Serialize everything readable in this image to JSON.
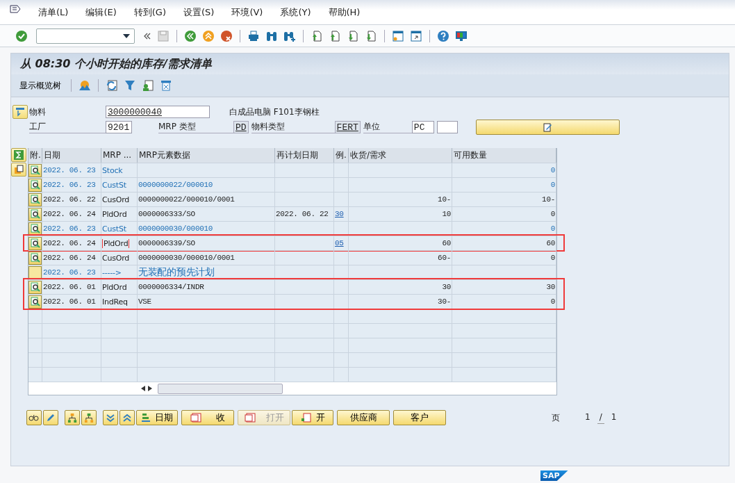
{
  "menu": [
    "清单(L)",
    "编辑(E)",
    "转到(G)",
    "设置(S)",
    "环境(V)",
    "系统(Y)",
    "帮助(H)"
  ],
  "title": "从 08:30 个小时开始的库存/需求清单",
  "app_toolbar": {
    "button": "显示概览树"
  },
  "header": {
    "material_label": "物料",
    "material": "3000000040",
    "description": "白成品电脑 F101李钢柱",
    "plant_label": "工厂",
    "plant": "9201",
    "mrp_type_label": "MRP 类型",
    "mrp_type": "PD",
    "material_type_label": "物料类型",
    "material_type": "FERT",
    "unit_label": "单位",
    "unit": "PC"
  },
  "table": {
    "columns": [
      "附.",
      "日期",
      "MRP ...",
      "MRP元素数据",
      "再计划日期",
      "例.",
      "收货/需求",
      "可用数量"
    ],
    "rows": [
      {
        "kind": "detail",
        "secondary": true,
        "highlighted": false,
        "type_marked": false,
        "date": "2022. 06. 23",
        "mrp": "Stock",
        "available": "0"
      },
      {
        "kind": "detail",
        "secondary": true,
        "highlighted": false,
        "type_marked": false,
        "date": "2022. 06. 23",
        "mrp": "CustSt",
        "element": "0000000022/000010",
        "available": "0"
      },
      {
        "kind": "detail",
        "secondary": false,
        "highlighted": false,
        "type_marked": false,
        "date": "2022. 06. 22",
        "mrp": "CusOrd",
        "element": "0000000022/000010/0001",
        "quantity": "10-",
        "available": "10-"
      },
      {
        "kind": "detail",
        "secondary": false,
        "highlighted": false,
        "type_marked": false,
        "date": "2022. 06. 24",
        "mrp": "PldOrd",
        "element": "0000006333/SO",
        "reschedule": "2022. 06. 22",
        "exception": "30",
        "quantity": "10",
        "available": "0"
      },
      {
        "kind": "detail",
        "secondary": true,
        "highlighted": false,
        "type_marked": false,
        "date": "2022. 06. 23",
        "mrp": "CustSt",
        "element": "0000000030/000010",
        "available": "0"
      },
      {
        "kind": "detail",
        "secondary": false,
        "highlighted": true,
        "type_marked": true,
        "date": "2022. 06. 24",
        "mrp": "PldOrd",
        "element": "0000006339/SO",
        "exception": "05",
        "quantity": "60",
        "available": "60"
      },
      {
        "kind": "detail",
        "secondary": false,
        "highlighted": false,
        "type_marked": false,
        "date": "2022. 06. 24",
        "mrp": "CusOrd",
        "element": "0000000030/000010/0001",
        "quantity": "60-",
        "available": "0"
      },
      {
        "kind": "blank",
        "secondary": true,
        "highlighted": false,
        "type_marked": false,
        "date": "2022. 06. 23",
        "mrp": "----->",
        "element": "无装配的预先计划"
      },
      {
        "kind": "detail",
        "secondary": false,
        "highlighted": true,
        "type_marked": false,
        "date": "2022. 06. 01",
        "mrp": "PldOrd",
        "element": "0000006334/INDR",
        "quantity": "30",
        "available": "30"
      },
      {
        "kind": "detail",
        "secondary": false,
        "highlighted": true,
        "type_marked": false,
        "date": "2022. 06. 01",
        "mrp": "IndReq",
        "element": "VSE",
        "quantity": "30-",
        "available": "0"
      }
    ]
  },
  "buttons": [
    {
      "kind": "sort",
      "label": "日期",
      "disabled": false
    },
    {
      "kind": "calendar",
      "label": "收",
      "disabled": false
    },
    {
      "kind": "calendar",
      "label": "打开",
      "disabled": true
    },
    {
      "kind": "note",
      "label": "开",
      "disabled": false
    },
    {
      "kind": "text",
      "label": "供应商",
      "disabled": false
    },
    {
      "kind": "text",
      "label": "客户",
      "disabled": false
    }
  ],
  "pager": {
    "label": "页",
    "current": "1",
    "separator": "/",
    "total": "1"
  },
  "logo": "SAP"
}
